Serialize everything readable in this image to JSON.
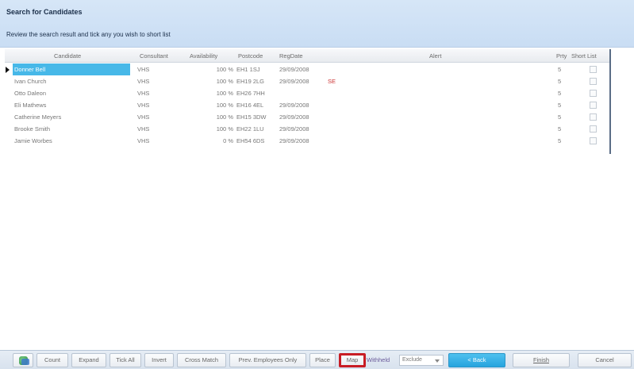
{
  "header": {
    "title": "Search for Candidates",
    "subtitle": "Review the search result and tick any you wish to short list"
  },
  "grid": {
    "columns": {
      "candidate": "Candidate",
      "consultant": "Consultant",
      "availability": "Availability",
      "postcode": "Postcode",
      "regdate": "RegDate",
      "alert": "Alert",
      "prty": "Prty",
      "short_list": "Short List"
    },
    "rows": [
      {
        "candidate": "Donner Bell",
        "consultant": "VHS",
        "availability": "100 %",
        "postcode": "EH1 1SJ",
        "regdate": "29/09/2008",
        "alert": "",
        "prty": "5",
        "short_list": false
      },
      {
        "candidate": "Ivan Church",
        "consultant": "VHS",
        "availability": "100 %",
        "postcode": "EH19 2LG",
        "regdate": "29/09/2008",
        "alert": "SE",
        "prty": "5",
        "short_list": false
      },
      {
        "candidate": "Otto Daleon",
        "consultant": "VHS",
        "availability": "100 %",
        "postcode": "EH26 7HH",
        "regdate": "",
        "alert": "",
        "prty": "5",
        "short_list": false
      },
      {
        "candidate": "Eli Mathews",
        "consultant": "VHS",
        "availability": "100 %",
        "postcode": "EH16 4EL",
        "regdate": "29/09/2008",
        "alert": "",
        "prty": "5",
        "short_list": false
      },
      {
        "candidate": "Catherine Meyers",
        "consultant": "VHS",
        "availability": "100 %",
        "postcode": "EH15 3DW",
        "regdate": "29/09/2008",
        "alert": "",
        "prty": "5",
        "short_list": false
      },
      {
        "candidate": "Brooke Smith",
        "consultant": "VHS",
        "availability": "100 %",
        "postcode": "EH22 1LU",
        "regdate": "29/09/2008",
        "alert": "",
        "prty": "5",
        "short_list": false
      },
      {
        "candidate": "Jamie Worbes",
        "consultant": "VHS",
        "availability": "0 %",
        "postcode": "EH54 6DS",
        "regdate": "29/09/2008",
        "alert": "",
        "prty": "5",
        "short_list": false
      }
    ]
  },
  "toolbar": {
    "count": "Count",
    "expand": "Expand",
    "tick_all": "Tick All",
    "invert": "Invert",
    "cross_match": "Cross Match",
    "prev_employees_only": "Prev. Employees Only",
    "place": "Place",
    "map": "Map",
    "withhold_label": "Withheld",
    "withhold_value": "Exclude",
    "back": "< Back",
    "finish": "Finish",
    "cancel": "Cancel"
  },
  "colors": {
    "header_bg": "#cfe1f5",
    "selected_row": "#47b8e8",
    "map_highlight": "#c81d25",
    "alert_text": "#cc3333"
  }
}
